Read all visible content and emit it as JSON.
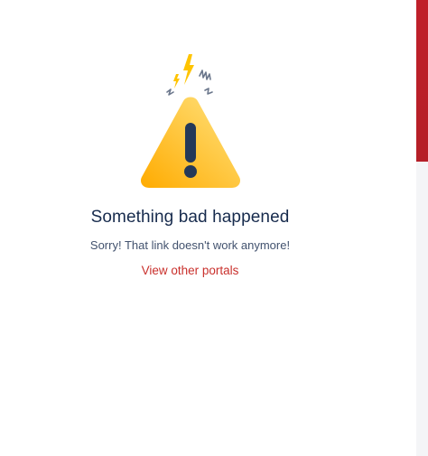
{
  "error": {
    "title": "Something bad happened",
    "message": "Sorry! That link doesn't work anymore!",
    "link_label": "View other portals"
  },
  "icons": {
    "illustration": "warning-triangle-icon",
    "bolt": "lightning-bolt-icon",
    "squiggle": "squiggle-icon"
  },
  "colors": {
    "title": "#172b4d",
    "message": "#42526e",
    "link": "#c9302c",
    "warning_yellow": "#ffc400",
    "scrollbar_thumb": "#c0202a"
  }
}
